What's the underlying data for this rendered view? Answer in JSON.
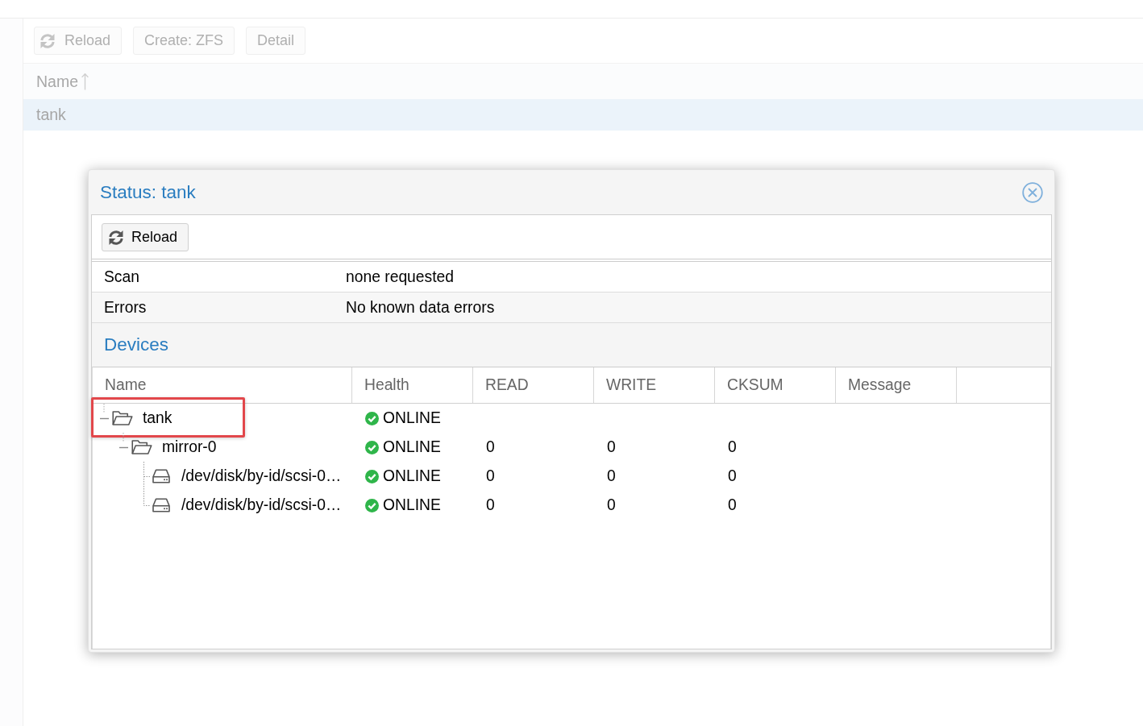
{
  "toolbar": {
    "reload": "Reload",
    "buttons": [
      "Create: ZFS",
      "Detail"
    ]
  },
  "pool_list": {
    "columns": [
      {
        "label": "Name",
        "sorted_ascending": true
      }
    ],
    "rows": [
      {
        "name": "tank",
        "selected": true
      }
    ]
  },
  "dialog": {
    "title": "Status: tank",
    "reload": "Reload",
    "properties": [
      {
        "label": "Scan",
        "value": "none requested"
      },
      {
        "label": "Errors",
        "value": "No known data errors"
      }
    ],
    "devices": {
      "title": "Devices",
      "columns": [
        "Name",
        "Health",
        "READ",
        "WRITE",
        "CKSUM",
        "Message"
      ],
      "rows": [
        {
          "name": "tank",
          "kind": "pool",
          "expanded": true,
          "highlighted": true,
          "health": "ONLINE",
          "children": [
            {
              "name": "mirror-0",
              "kind": "vdev",
              "expanded": true,
              "highlighted": false,
              "health": "ONLINE",
              "read": "0",
              "write": "0",
              "cksum": "0",
              "children": [
                {
                  "name": "/dev/disk/by-id/scsi-0…",
                  "kind": "disk",
                  "highlighted": false,
                  "health": "ONLINE",
                  "read": "0",
                  "write": "0",
                  "cksum": "0"
                },
                {
                  "name": "/dev/disk/by-id/scsi-0…",
                  "kind": "disk",
                  "highlighted": false,
                  "health": "ONLINE",
                  "read": "0",
                  "write": "0",
                  "cksum": "0"
                }
              ]
            }
          ]
        }
      ]
    }
  }
}
